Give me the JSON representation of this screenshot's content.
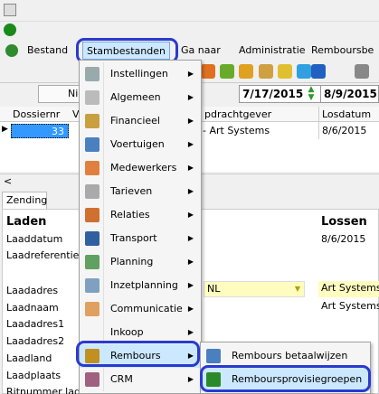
{
  "window": {
    "title": ""
  },
  "menubar": {
    "items": [
      "Bestand",
      "Stambestanden",
      "Ga naar",
      "Administratie",
      "Remboursbe"
    ]
  },
  "date_range": {
    "from": "7/17/2015",
    "to": "8/9/2015"
  },
  "toolbar": {
    "nieuw_label": "Nie"
  },
  "grid": {
    "headers": [
      "Dossiernr",
      "V",
      "pdrachtgever",
      "Losdatum"
    ],
    "row": {
      "dossiernr": "33",
      "opdrachtgever": "- Art Systems",
      "losdatum": "8/6/2015"
    }
  },
  "tabs": {
    "zending": "Zending"
  },
  "laden": {
    "title": "Laden",
    "fields": [
      "Laaddatum",
      "Laadreferentie",
      "Laadadres",
      "Laadnaam",
      "Laadadres1",
      "Laadadres2",
      "Laadland",
      "Laadplaats",
      "Ritnummer laden"
    ]
  },
  "lossen": {
    "title": "Lossen",
    "date": "8/6/2015",
    "adres": "Art Systems -",
    "naam": "Art Systems"
  },
  "ladres_value": "NL",
  "stambestanden_menu": {
    "items": [
      "Instellingen",
      "Algemeen",
      "Financieel",
      "Voertuigen",
      "Medewerkers",
      "Tarieven",
      "Relaties",
      "Transport",
      "Planning",
      "Inzetplanning",
      "Communicatie",
      "Inkoop",
      "Rembours",
      "CRM"
    ]
  },
  "rembours_submenu": {
    "items": [
      "Rembours betaalwijzen",
      "Remboursprovisiegroepen"
    ]
  },
  "colors": {
    "highlight": "#2a3ad0",
    "selection": "#cce8ff",
    "date_text": "#000000",
    "grid_cell": "#3399ff"
  }
}
